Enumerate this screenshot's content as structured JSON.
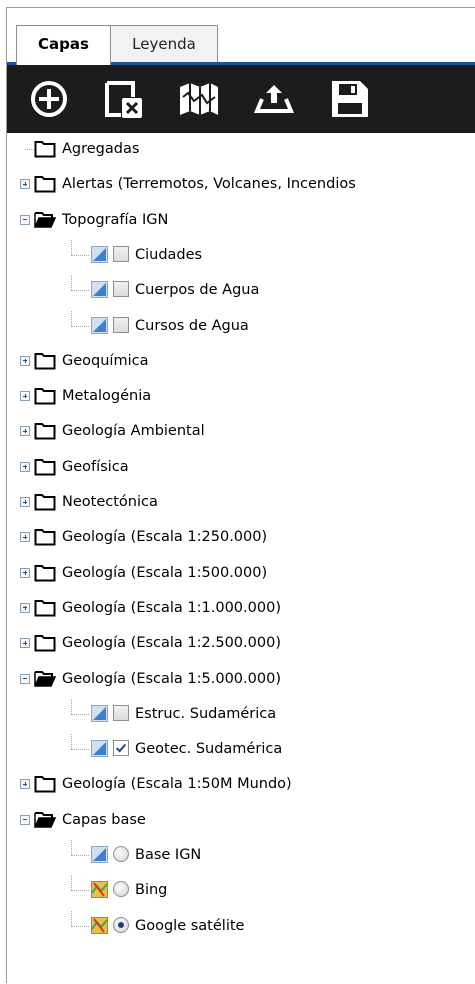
{
  "tabs": [
    {
      "label": "Capas",
      "active": true
    },
    {
      "label": "Leyenda",
      "active": false
    }
  ],
  "toolbar": {
    "icons": [
      "add-layer-icon",
      "remove-layer-icon",
      "map-icon",
      "upload-icon",
      "save-icon"
    ],
    "background": "#1c1c1c",
    "accent": "#1e4fa0"
  },
  "tree": [
    {
      "label": "Agregadas",
      "type": "folder",
      "expanded": false,
      "toggle": false
    },
    {
      "label": "Alertas (Terremotos, Volcanes, Incendios",
      "type": "folder",
      "expanded": false,
      "toggle": true
    },
    {
      "label": "Topografía IGN",
      "type": "folder",
      "expanded": true,
      "toggle": true
    },
    {
      "label": "Ciudades",
      "type": "layer",
      "checked": false
    },
    {
      "label": "Cuerpos de Agua",
      "type": "layer",
      "checked": false
    },
    {
      "label": "Cursos de Agua",
      "type": "layer",
      "checked": false
    },
    {
      "label": "Geoquímica",
      "type": "folder",
      "expanded": false,
      "toggle": true
    },
    {
      "label": "Metalogénia",
      "type": "folder",
      "expanded": false,
      "toggle": true
    },
    {
      "label": "Geología Ambiental",
      "type": "folder",
      "expanded": false,
      "toggle": true
    },
    {
      "label": "Geofísica",
      "type": "folder",
      "expanded": false,
      "toggle": true
    },
    {
      "label": "Neotectónica",
      "type": "folder",
      "expanded": false,
      "toggle": true
    },
    {
      "label": "Geología (Escala 1:250.000)",
      "type": "folder",
      "expanded": false,
      "toggle": true
    },
    {
      "label": "Geología (Escala 1:500.000)",
      "type": "folder",
      "expanded": false,
      "toggle": true
    },
    {
      "label": "Geología (Escala 1:1.000.000)",
      "type": "folder",
      "expanded": false,
      "toggle": true
    },
    {
      "label": "Geología (Escala 1:2.500.000)",
      "type": "folder",
      "expanded": false,
      "toggle": true
    },
    {
      "label": "Geología (Escala 1:5.000.000)",
      "type": "folder",
      "expanded": true,
      "toggle": true
    },
    {
      "label": "Estruc. Sudamérica",
      "type": "layer",
      "checked": false
    },
    {
      "label": "Geotec. Sudamérica",
      "type": "layer",
      "checked": true
    },
    {
      "label": "Geología (Escala 1:50M Mundo)",
      "type": "folder",
      "expanded": false,
      "toggle": true
    },
    {
      "label": "Capas base",
      "type": "folder",
      "expanded": true,
      "toggle": true
    },
    {
      "label": "Base IGN",
      "type": "base",
      "selected": false,
      "icon": "layer-icon"
    },
    {
      "label": "Bing",
      "type": "base",
      "selected": false,
      "icon": "map-tile-icon"
    },
    {
      "label": "Google satélite",
      "type": "base",
      "selected": true,
      "icon": "map-tile-icon"
    }
  ]
}
